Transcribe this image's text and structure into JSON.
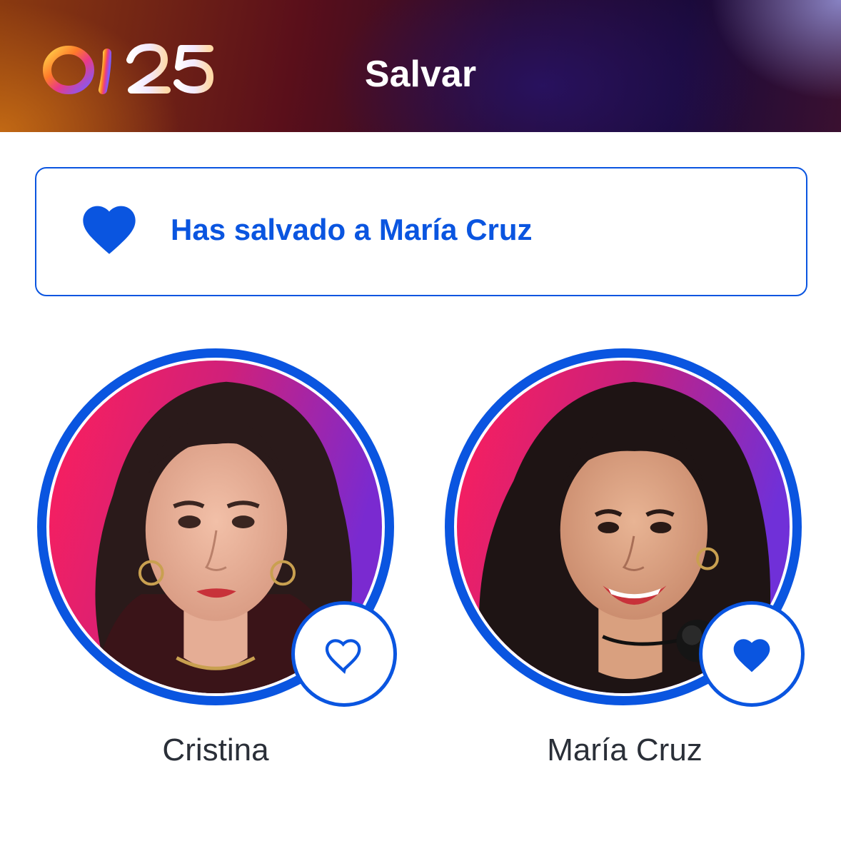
{
  "header": {
    "logo_text": "OT25",
    "title": "Salvar"
  },
  "banner": {
    "icon": "heart-filled-icon",
    "message": "Has salvado a María Cruz"
  },
  "colors": {
    "accent": "#0a55e0",
    "text": "#2a2f38"
  },
  "candidates": [
    {
      "name": "Cristina",
      "saved": false,
      "icon": "heart-outline-icon"
    },
    {
      "name": "María Cruz",
      "saved": true,
      "icon": "heart-filled-icon"
    }
  ]
}
